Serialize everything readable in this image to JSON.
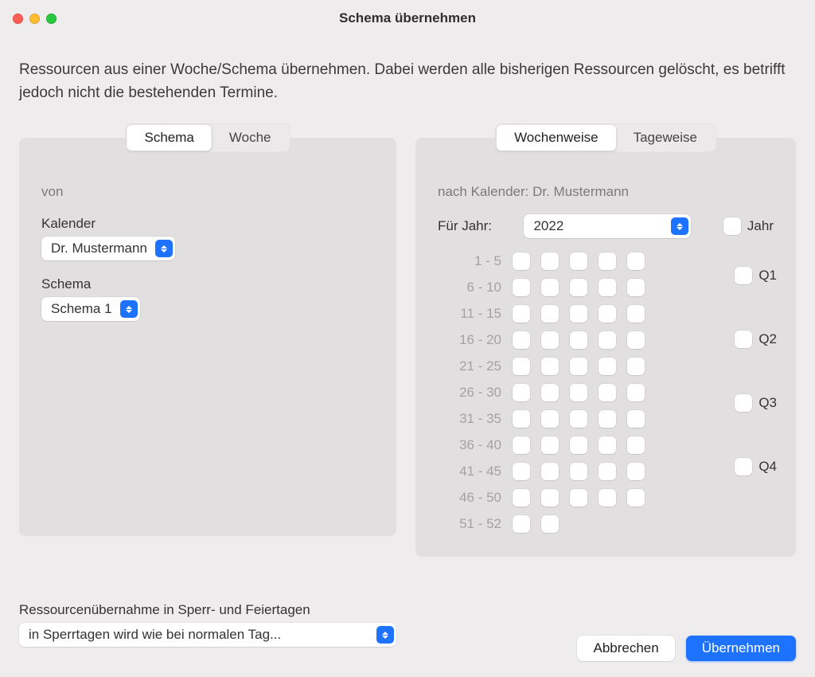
{
  "window": {
    "title": "Schema übernehmen"
  },
  "intro": "Ressourcen aus einer Woche/Schema übernehmen. Dabei werden alle bisherigen Ressourcen gelöscht, es betrifft jedoch nicht die bestehenden Termine.",
  "left": {
    "tabs": {
      "active": "Schema",
      "other": "Woche"
    },
    "von": "von",
    "kalender_label": "Kalender",
    "kalender_value": "Dr. Mustermann",
    "schema_label": "Schema",
    "schema_value": "Schema 1"
  },
  "sperr": {
    "label": "Ressourcenübernahme in Sperr- und Feiertagen",
    "value": "in Sperrtagen wird wie bei normalen Tag..."
  },
  "right": {
    "tabs": {
      "active": "Wochenweise",
      "other": "Tageweise"
    },
    "nach": "nach Kalender: Dr. Mustermann",
    "year_label": "Für Jahr:",
    "year_value": "2022",
    "jahr": "Jahr",
    "ranges": [
      "1 -  5",
      "6 - 10",
      "11 - 15",
      "16 - 20",
      "21 - 25",
      "26 - 30",
      "31 - 35",
      "36 - 40",
      "41 - 45",
      "46 - 50",
      "51 - 52"
    ],
    "boxes_per_row": [
      5,
      5,
      5,
      5,
      5,
      5,
      5,
      5,
      5,
      5,
      2
    ],
    "quarters": [
      "Q1",
      "Q2",
      "Q3",
      "Q4"
    ]
  },
  "footer": {
    "cancel": "Abbrechen",
    "confirm": "Übernehmen"
  }
}
